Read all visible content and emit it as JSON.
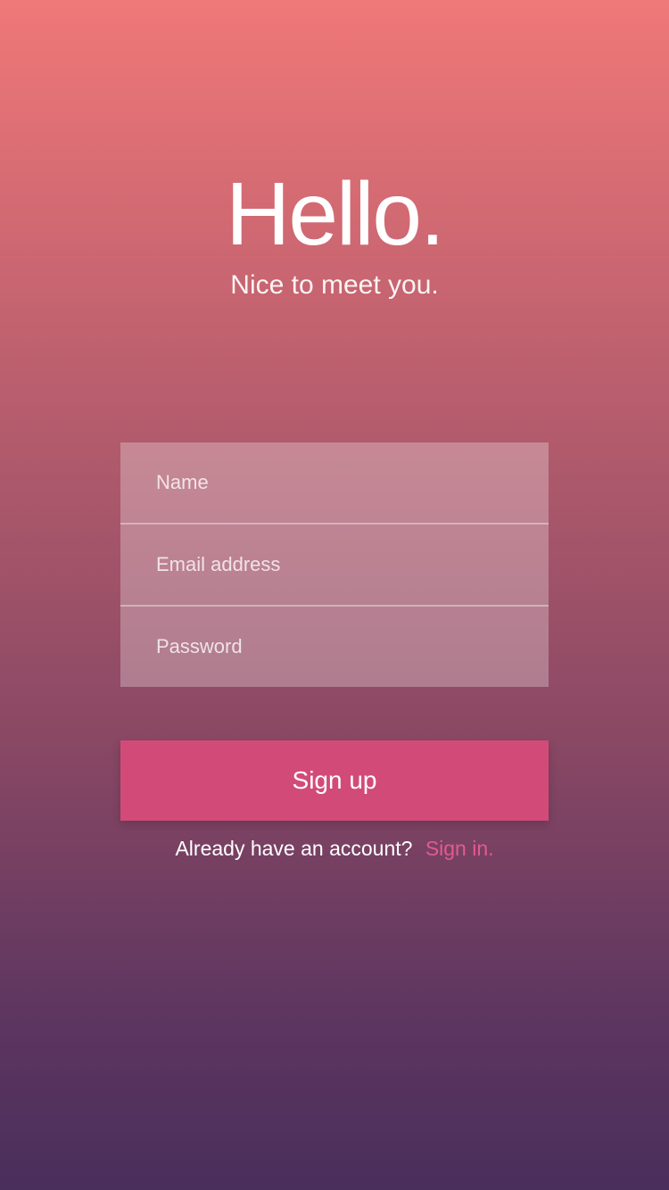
{
  "greeting": {
    "title": "Hello.",
    "subtitle": "Nice to meet you."
  },
  "form": {
    "name_placeholder": "Name",
    "email_placeholder": "Email address",
    "password_placeholder": "Password"
  },
  "actions": {
    "signup_label": "Sign up",
    "signin_prompt": "Already have an account?",
    "signin_link": "Sign in."
  },
  "colors": {
    "gradient_top": "#f07878",
    "gradient_bottom": "#4a2e5c",
    "button": "#d24b78",
    "link": "#e35a8e"
  }
}
